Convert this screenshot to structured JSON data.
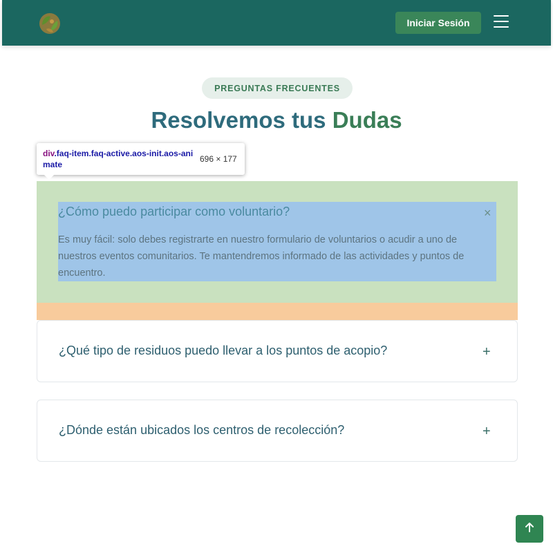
{
  "header": {
    "logo_icon": "leaf-logo-icon",
    "login_label": "Iniciar Sesión",
    "menu_icon": "hamburger-menu-icon"
  },
  "faq_section": {
    "badge": "PREGUNTAS FRECUENTES",
    "title_main": "Resolvemos tus",
    "title_accent": "Dudas",
    "items": [
      {
        "question": "¿Cómo puedo participar como voluntario?",
        "answer": "Es muy fácil: solo debes registrarte en nuestro formulario de voluntarios o acudir a uno de nuestros eventos comunitarios. Te mantendremos informado de las actividades y puntos de encuentro.",
        "toggle": "×",
        "expanded": true
      },
      {
        "question": "¿Qué tipo de residuos puedo llevar a los puntos de acopio?",
        "toggle": "+",
        "expanded": false
      },
      {
        "question": "¿Dónde están ubicados los centros de recolección?",
        "toggle": "+",
        "expanded": false
      }
    ]
  },
  "devtools_tooltip": {
    "tag": "div",
    "classes": ".faq-item.faq-active.aos-init.aos-animate",
    "size": "696 × 177"
  },
  "back_to_top_icon": "arrow-up-icon",
  "colors": {
    "header_bg": "#1b6760",
    "primary_green": "#3a8659",
    "title_blue": "#2e6b7c",
    "title_accent": "#3a7e57"
  }
}
